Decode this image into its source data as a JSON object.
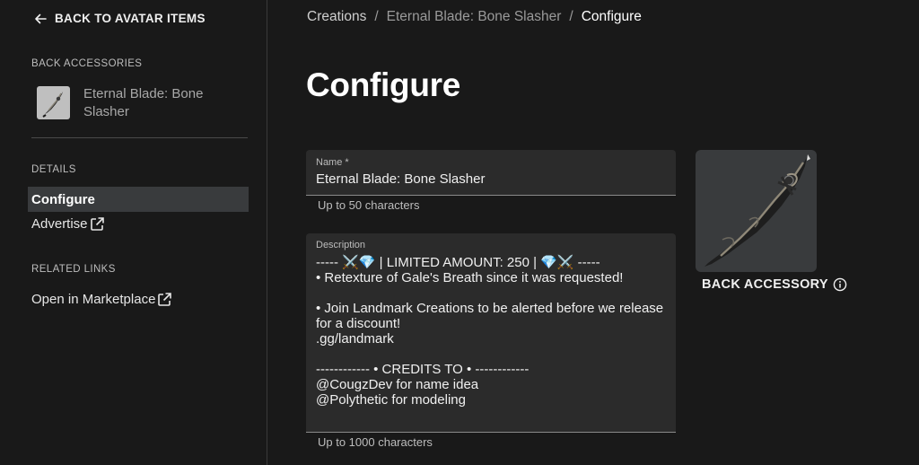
{
  "sidebar": {
    "back_label": "BACK TO AVATAR ITEMS",
    "category_title": "BACK ACCESSORIES",
    "item_name": "Eternal Blade: Bone Slasher",
    "details_title": "DETAILS",
    "configure_label": "Configure",
    "advertise_label": "Advertise",
    "related_title": "RELATED LINKS",
    "marketplace_label": "Open in Marketplace"
  },
  "breadcrumb": {
    "items": [
      "Creations",
      "Eternal Blade: Bone Slasher",
      "Configure"
    ],
    "separator": "/"
  },
  "page_title": "Configure",
  "form": {
    "name_label": "Name *",
    "name_value": "Eternal Blade: Bone Slasher",
    "name_helper": "Up to 50 characters",
    "description_label": "Description",
    "description_value": "----- ⚔️💎 | LIMITED AMOUNT: 250 | 💎⚔️ -----\n• Retexture of Gale's Breath since it was requested!\n\n• Join Landmark Creations to be alerted before we release for a discount!\n.gg/landmark\n\n------------ • CREDITS TO • ------------\n@CougzDev for name idea\n@Polythetic for modeling",
    "description_helper": "Up to 1000 characters"
  },
  "preview": {
    "label": "BACK ACCESSORY",
    "info_icon": "info-icon"
  },
  "colors": {
    "background": "#191919",
    "active_nav": "#393b3d",
    "field_bg": "#2b2b2b",
    "text_primary": "#ffffff",
    "text_muted": "#bdbdbd"
  }
}
